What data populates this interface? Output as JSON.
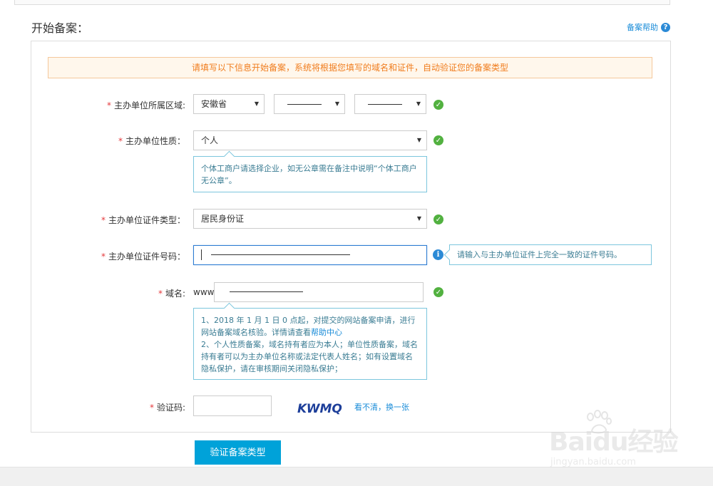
{
  "header": {
    "title": "开始备案：",
    "help_label": "备案帮助",
    "help_icon": "question-icon"
  },
  "notice": "请填写以下信息开始备案，系统将根据您填写的域名和证件，自动验证您的备案类型",
  "form": {
    "region": {
      "label": "主办单位所属区域:",
      "province": "安徽省",
      "city": "",
      "district": ""
    },
    "nature": {
      "label": "主办单位性质：",
      "value": "个人",
      "tip": "个体工商户请选择企业，如无公章需在备注中说明“个体工商户无公章”。"
    },
    "cert_type": {
      "label": "主办单位证件类型：",
      "value": "居民身份证"
    },
    "cert_number": {
      "label": "主办单位证件号码：",
      "value": "",
      "tip": "请输入与主办单位证件上完全一致的证件号码。"
    },
    "domain": {
      "label": "域名:",
      "prefix": "www.",
      "value": "",
      "tip1": "1、2018 年 1 月 1 日 0 点起，对提交的网站备案申请，进行网站备案域名核验。详情请查看",
      "tip_link": "帮助中心",
      "tip2": "2、个人性质备案，域名持有者应为本人；单位性质备案，域名持有者可以为主办单位名称或法定代表人姓名；如有设置域名隐私保护，请在审核期间关闭隐私保护；"
    },
    "captcha": {
      "label": "验证码:",
      "value": "",
      "image_text": "KWMQ",
      "refresh_label": "看不清，换一张"
    }
  },
  "submit_label": "验证备案类型",
  "watermark": {
    "brand": "Baidu经验",
    "url": "jingyan.baidu.com"
  },
  "colors": {
    "accent": "#00a2d9",
    "ok": "#52b140",
    "required": "#e4393c",
    "notice_text": "#f07d1e"
  }
}
